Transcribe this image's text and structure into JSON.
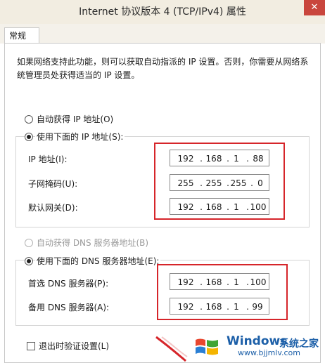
{
  "window": {
    "title": "Internet 协议版本 4 (TCP/IPv4) 属性",
    "close": "✕"
  },
  "tabs": [
    {
      "label": "常规"
    }
  ],
  "description": "如果网络支持此功能，则可以获取自动指派的 IP 设置。否则，你需要从网络系统管理员处获得适当的 IP 设置。",
  "ip_section": {
    "auto_label": "自动获得 IP 地址(O)",
    "manual_label": "使用下面的 IP 地址(S):",
    "auto_selected": false,
    "fields": [
      {
        "label": "IP 地址(I):",
        "octets": [
          "192",
          "168",
          "1",
          "88"
        ]
      },
      {
        "label": "子网掩码(U):",
        "octets": [
          "255",
          "255",
          "255",
          "0"
        ]
      },
      {
        "label": "默认网关(D):",
        "octets": [
          "192",
          "168",
          "1",
          "100"
        ]
      }
    ]
  },
  "dns_section": {
    "auto_label": "自动获得 DNS 服务器地址(B)",
    "manual_label": "使用下面的 DNS 服务器地址(E):",
    "fields": [
      {
        "label": "首选 DNS 服务器(P):",
        "octets": [
          "192",
          "168",
          "1",
          "100"
        ]
      },
      {
        "label": "备用 DNS 服务器(A):",
        "octets": [
          "192",
          "168",
          "1",
          "99"
        ]
      }
    ]
  },
  "validate_checkbox": {
    "label": "退出时验证设置(L)",
    "checked": false
  },
  "watermark": {
    "brand": "Windows",
    "cn": "系统之家",
    "url": "www.bjjmlv.com"
  },
  "colors": {
    "highlight": "#d6252a",
    "titlebar": "#f2ede1",
    "watermark": "#1c5fa8"
  }
}
